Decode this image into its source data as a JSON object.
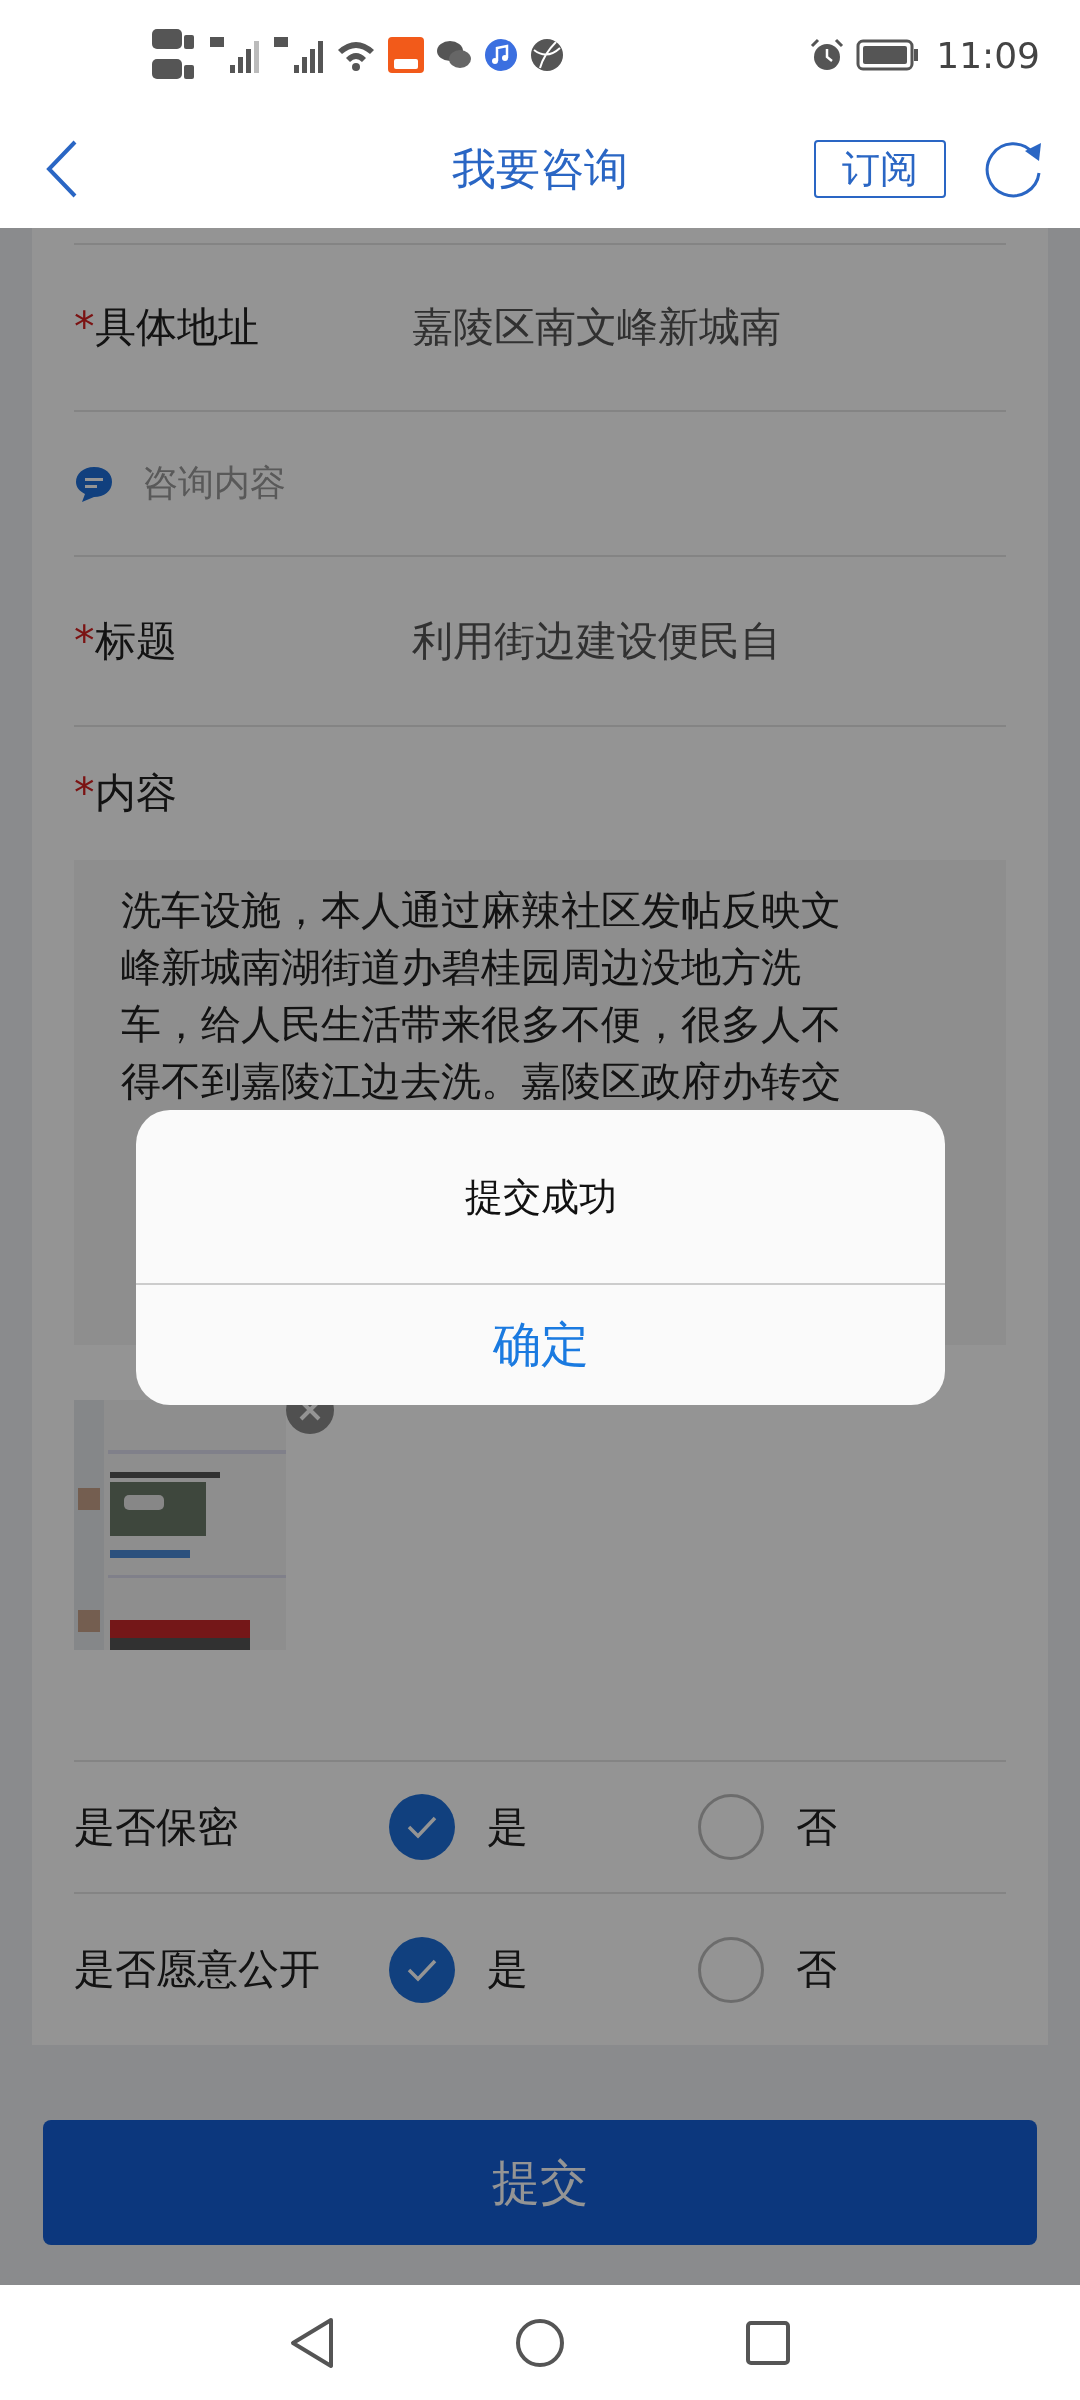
{
  "status_bar": {
    "time": "11:09"
  },
  "header": {
    "title": "我要咨询",
    "subscribe_button": "订阅"
  },
  "form": {
    "address": {
      "marker": "*",
      "label": "具体地址",
      "value": "嘉陵区南文峰新城南"
    },
    "section": {
      "title": "咨询内容"
    },
    "title_field": {
      "marker": "*",
      "label": "标题",
      "value": "利用街边建设便民自"
    },
    "content": {
      "marker": "*",
      "label": "内容",
      "lines": [
        "洗车设施，本人通过麻辣社区发帖反映文",
        "峰新城南湖街道办碧桂园周边没地方洗",
        "车，给人民生活带来很多不便，很多人不",
        "得不到嘉陵江边去洗。嘉陵区政府办转交"
      ]
    },
    "options": [
      {
        "label": "是否保密",
        "choices": [
          {
            "label": "是",
            "selected": true
          },
          {
            "label": "否",
            "selected": false
          }
        ]
      },
      {
        "label": "是否愿意公开",
        "choices": [
          {
            "label": "是",
            "selected": true
          },
          {
            "label": "否",
            "selected": false
          }
        ]
      }
    ]
  },
  "submit_button": "提交",
  "dialog": {
    "message": "提交成功",
    "confirm": "确定"
  }
}
